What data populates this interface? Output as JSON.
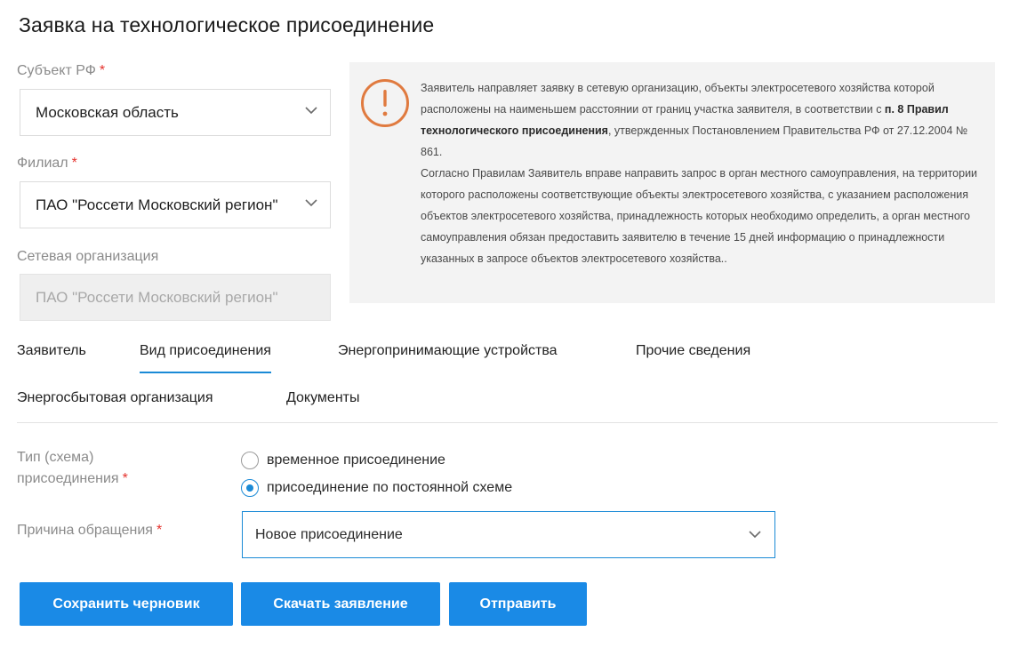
{
  "page": {
    "title": "Заявка на технологическое присоединение"
  },
  "region": {
    "label": "Субъект РФ",
    "value": "Московская область"
  },
  "branch": {
    "label": "Филиал",
    "value": "ПАО \"Россети Московский регион\""
  },
  "network_org": {
    "label": "Сетевая организация",
    "value": "ПАО \"Россети Московский регион\""
  },
  "required_mark": "*",
  "info": {
    "p1_before": "Заявитель направляет заявку в сетевую организацию, объекты электросетевого хозяйства которой расположены на наименьшем расстоянии от границ участка заявителя, в соответствии с ",
    "p1_bold": "п. 8 Правил технологического присоединения",
    "p1_after": ", утвержденных Постановлением Правительства РФ от 27.12.2004 № 861.",
    "p2": "Согласно Правилам Заявитель вправе направить запрос в орган местного самоуправления, на территории которого расположены соответствующие объекты электросетевого хозяйства, с указанием расположения объектов электросетевого хозяйства, принадлежность которых необходимо определить, а орган местного самоуправления обязан предоставить заявителю в течение 15 дней информацию о принадлежности указанных в запросе объектов электросетевого хозяйства.."
  },
  "tabs": [
    {
      "label": "Заявитель",
      "active": false
    },
    {
      "label": "Вид присоединения",
      "active": true
    },
    {
      "label": "Энергопринимающие устройства",
      "active": false
    },
    {
      "label": "Прочие сведения",
      "active": false
    },
    {
      "label": "Энергосбытовая организация",
      "active": false
    },
    {
      "label": "Документы",
      "active": false
    }
  ],
  "connection_type": {
    "label_line1": "Тип (схема)",
    "label_line2": "присоединения",
    "options": [
      {
        "label": "временное присоединение",
        "checked": false
      },
      {
        "label": "присоединение по постоянной схеме",
        "checked": true
      }
    ]
  },
  "reason": {
    "label": "Причина обращения",
    "value": "Новое присоединение"
  },
  "buttons": {
    "save_draft": "Сохранить черновик",
    "download": "Скачать заявление",
    "submit": "Отправить"
  },
  "colors": {
    "accent": "#1a8ae6",
    "warning": "#e07a3f",
    "required": "#e5322d"
  },
  "icons": {
    "info": "exclamation-circle-icon",
    "dropdown": "chevron-down-icon"
  }
}
